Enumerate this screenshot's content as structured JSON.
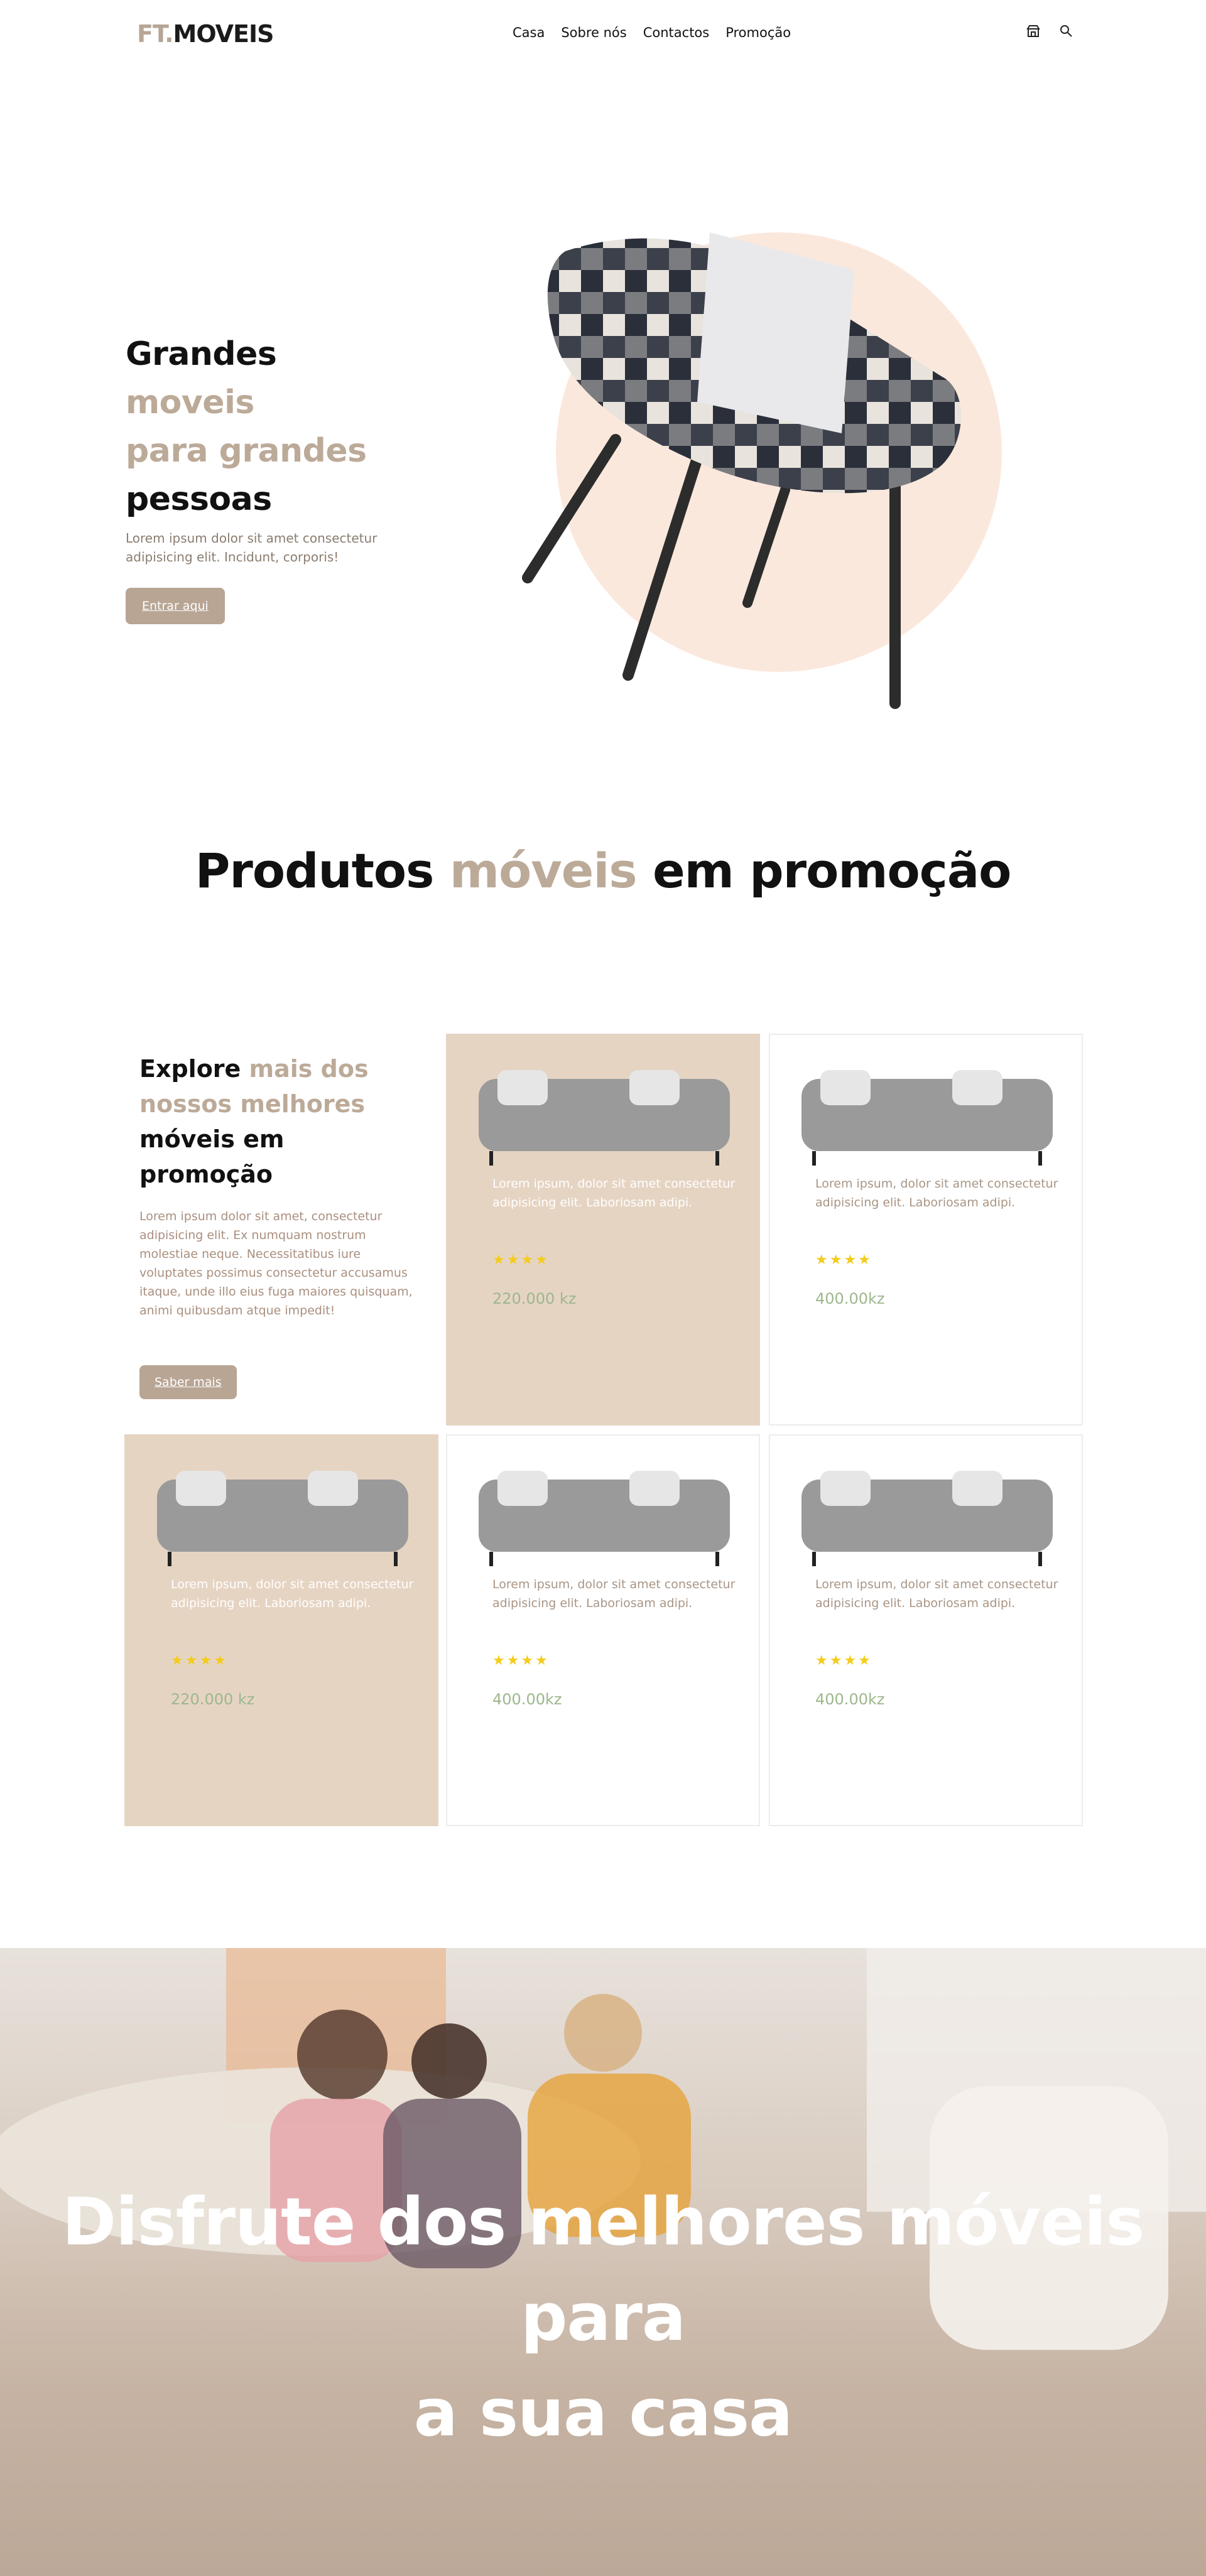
{
  "nav": {
    "logo_prefix": "FT.",
    "logo_main": "MOVEIS",
    "menu": [
      "Casa",
      "Sobre nós",
      "Contactos",
      "Promoção"
    ],
    "icons": [
      "store-icon",
      "search-icon"
    ]
  },
  "hero": {
    "title_line1_a": "Grandes ",
    "title_line1_b": "moveis",
    "title_line2": "para grandes",
    "title_line3": "pessoas",
    "description": "Lorem ipsum dolor sit amet consectetur adipisicing elit. Incidunt, corporis!",
    "button": "Entrar aqui"
  },
  "section": {
    "title_a": "Produtos ",
    "title_b": "móveis",
    "title_c": " em promoção"
  },
  "intro": {
    "title_a": "Explore ",
    "title_b": "mais dos nossos melhores",
    "title_c": "móveis em promoção",
    "description": "Lorem ipsum dolor sit amet, consectetur adipisicing elit. Ex numquam nostrum molestiae neque. Necessitatibus iure voluptates possimus consectetur accusamus itaque, unde illo eius fuga maiores quisquam, animi quibusdam atque impedit!",
    "button": "Saber mais"
  },
  "products": [
    {
      "text": "Lorem ipsum, dolor sit amet consectetur adipisicing elit. Laboriosam adipi.",
      "stars": "★★★★",
      "price": "220.000 kz"
    },
    {
      "text": "Lorem ipsum, dolor sit amet consectetur adipisicing elit. Laboriosam adipi.",
      "stars": "★★★★",
      "price": "400.00kz"
    },
    {
      "text": "Lorem ipsum, dolor sit amet consectetur adipisicing elit. Laboriosam adipi.",
      "stars": "★★★★",
      "price": "220.000 kz"
    },
    {
      "text": "Lorem ipsum, dolor sit amet consectetur adipisicing elit. Laboriosam adipi.",
      "stars": "★★★★",
      "price": "400.00kz"
    },
    {
      "text": "Lorem ipsum, dolor sit amet consectetur adipisicing elit. Laboriosam adipi.",
      "stars": "★★★★",
      "price": "400.00kz"
    }
  ],
  "banner": {
    "line1": "Disfrute dos melhores móveis para",
    "line2": "a sua casa"
  },
  "colors": {
    "accent": "#bcaa98",
    "button": "#b8a594",
    "card_tan": "#e6d4c3",
    "price": "#9cb88c",
    "star": "#f4cc1a"
  }
}
